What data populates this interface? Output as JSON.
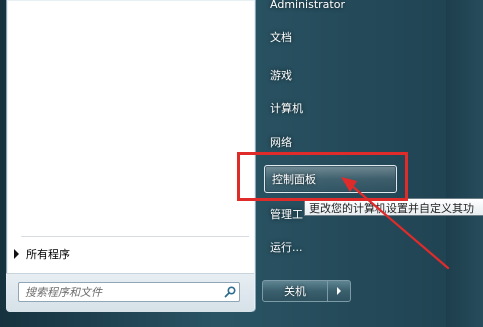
{
  "start_menu": {
    "left_pane": {
      "all_programs_label": "所有程序",
      "search_placeholder": "搜索程序和文件"
    },
    "right_pane": {
      "items": [
        {
          "label": "Administrator"
        },
        {
          "label": "文档"
        },
        {
          "label": "游戏"
        },
        {
          "label": "计算机"
        },
        {
          "label": "网络"
        },
        {
          "label": "控制面板"
        },
        {
          "label": "管理工"
        },
        {
          "label": "运行..."
        }
      ],
      "highlighted_item": "控制面板"
    },
    "tooltip": {
      "text": "更改您的计算机设置并自定义其功"
    },
    "shutdown": {
      "label": "关机"
    }
  },
  "annotation": {
    "box_color": "#e02b2b",
    "arrow_color": "#e02b2b"
  }
}
